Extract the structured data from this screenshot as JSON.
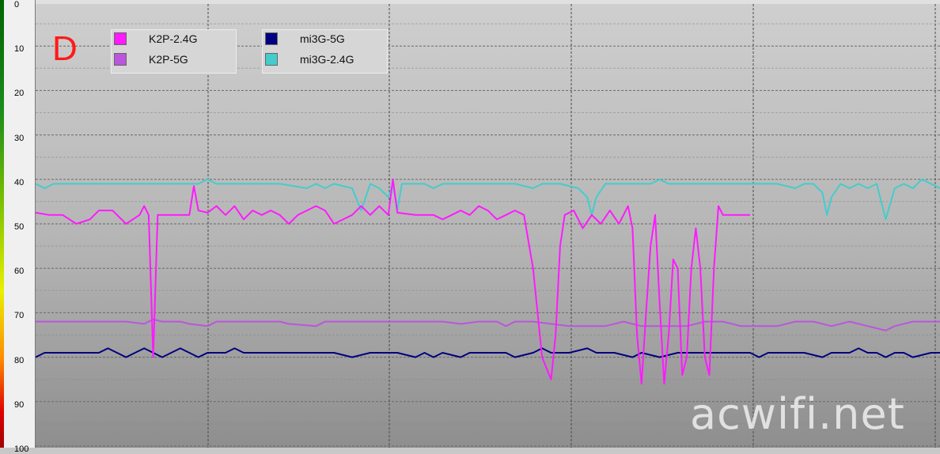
{
  "panel_label": "D",
  "watermark": "acwifi.net",
  "colors": {
    "k2p_24": "#ff1aff",
    "k2p_5": "#bb55dd",
    "mi3g_5": "#000080",
    "mi3g_24": "#44cccc"
  },
  "chart_data": {
    "type": "line",
    "ylim": [
      0,
      100
    ],
    "y_inverted": true,
    "yticks": [
      "0",
      "10",
      "20",
      "30",
      "40",
      "50",
      "60",
      "70",
      "80",
      "90",
      "100"
    ],
    "xlim": [
      0,
      100
    ],
    "grid": true,
    "legend_position": "top-left",
    "series": [
      {
        "name": "K2P-2.4G",
        "color": "#ff1aff",
        "points": [
          [
            0,
            47.5
          ],
          [
            1.5,
            48
          ],
          [
            3,
            48
          ],
          [
            4.5,
            50
          ],
          [
            6,
            49
          ],
          [
            7,
            47
          ],
          [
            8.5,
            47
          ],
          [
            10,
            50
          ],
          [
            11.5,
            48
          ],
          [
            12,
            46
          ],
          [
            12.5,
            48
          ],
          [
            13,
            80
          ],
          [
            13.5,
            48
          ],
          [
            15,
            48
          ],
          [
            17,
            48
          ],
          [
            17,
            48
          ],
          [
            17.5,
            41.5
          ],
          [
            18,
            47
          ],
          [
            19,
            47.5
          ],
          [
            20,
            46
          ],
          [
            21,
            48
          ],
          [
            22,
            46
          ],
          [
            23,
            49
          ],
          [
            24,
            47
          ],
          [
            25,
            48
          ],
          [
            26,
            47
          ],
          [
            27,
            48
          ],
          [
            28,
            50
          ],
          [
            29,
            48
          ],
          [
            30,
            47
          ],
          [
            31,
            46
          ],
          [
            32,
            47
          ],
          [
            33,
            50
          ],
          [
            34,
            49
          ],
          [
            35,
            48
          ],
          [
            36,
            46
          ],
          [
            37,
            48
          ],
          [
            38,
            46
          ],
          [
            39,
            48
          ],
          [
            39.5,
            40
          ],
          [
            40,
            47.5
          ],
          [
            42,
            48
          ],
          [
            44,
            48
          ],
          [
            45,
            49
          ],
          [
            46,
            48
          ],
          [
            47,
            47
          ],
          [
            48,
            48
          ],
          [
            49,
            46
          ],
          [
            50,
            47
          ],
          [
            51,
            49
          ],
          [
            52,
            48
          ],
          [
            53,
            47
          ],
          [
            54,
            48
          ],
          [
            55,
            60
          ],
          [
            56,
            80
          ],
          [
            57,
            85
          ],
          [
            57.5,
            75
          ],
          [
            58,
            55
          ],
          [
            58.5,
            48
          ],
          [
            59.5,
            47
          ],
          [
            60.5,
            51
          ],
          [
            61.5,
            48
          ],
          [
            62.5,
            50
          ],
          [
            63.5,
            47
          ],
          [
            64.5,
            50
          ],
          [
            65,
            48
          ],
          [
            65.5,
            46
          ],
          [
            66,
            51
          ],
          [
            66.5,
            75
          ],
          [
            67,
            86
          ],
          [
            67.5,
            70
          ],
          [
            68,
            55
          ],
          [
            68.5,
            48
          ],
          [
            69,
            68
          ],
          [
            69.5,
            86
          ],
          [
            70,
            75
          ],
          [
            70.5,
            58
          ],
          [
            71,
            60
          ],
          [
            71.5,
            84
          ],
          [
            72,
            80
          ],
          [
            72.5,
            60
          ],
          [
            73,
            51
          ],
          [
            73.5,
            60
          ],
          [
            74,
            80
          ],
          [
            74.5,
            84
          ],
          [
            75,
            60
          ],
          [
            75.5,
            46
          ],
          [
            76,
            48
          ],
          [
            78,
            48
          ],
          [
            79,
            48
          ]
        ]
      },
      {
        "name": "K2P-5G",
        "color": "#bb55dd",
        "points": [
          [
            0,
            72
          ],
          [
            5,
            72
          ],
          [
            10,
            72
          ],
          [
            12,
            72.5
          ],
          [
            13,
            71.5
          ],
          [
            14,
            72
          ],
          [
            16,
            72
          ],
          [
            17,
            72.5
          ],
          [
            19,
            73
          ],
          [
            20,
            72
          ],
          [
            25,
            72
          ],
          [
            26,
            72
          ],
          [
            27,
            72
          ],
          [
            28,
            72.5
          ],
          [
            31,
            73
          ],
          [
            32,
            72
          ],
          [
            35,
            72
          ],
          [
            37,
            72
          ],
          [
            40,
            72
          ],
          [
            42,
            72
          ],
          [
            45,
            72
          ],
          [
            47,
            72.5
          ],
          [
            49,
            72
          ],
          [
            50,
            72
          ],
          [
            51,
            72
          ],
          [
            52,
            73
          ],
          [
            53,
            72
          ],
          [
            55,
            72
          ],
          [
            57,
            72.5
          ],
          [
            59,
            73
          ],
          [
            60,
            73
          ],
          [
            63,
            73
          ],
          [
            65,
            72
          ],
          [
            67,
            73
          ],
          [
            70,
            73
          ],
          [
            72,
            73
          ],
          [
            74,
            72
          ],
          [
            76,
            72
          ],
          [
            78,
            73
          ],
          [
            82,
            73
          ],
          [
            84,
            72
          ],
          [
            86,
            72
          ],
          [
            88,
            73
          ],
          [
            90,
            72
          ],
          [
            92,
            73
          ],
          [
            94,
            74
          ],
          [
            95,
            73
          ],
          [
            97,
            72
          ],
          [
            99,
            72
          ],
          [
            100,
            72
          ]
        ]
      },
      {
        "name": "mi3G-5G",
        "color": "#000080",
        "points": [
          [
            0,
            80
          ],
          [
            1,
            79
          ],
          [
            5,
            79
          ],
          [
            7,
            79
          ],
          [
            8,
            78
          ],
          [
            9,
            79
          ],
          [
            10,
            80
          ],
          [
            11,
            79
          ],
          [
            12,
            78
          ],
          [
            13,
            79
          ],
          [
            14,
            80
          ],
          [
            15,
            79
          ],
          [
            16,
            78
          ],
          [
            17,
            79
          ],
          [
            18,
            80
          ],
          [
            19,
            79
          ],
          [
            21,
            79
          ],
          [
            22,
            78
          ],
          [
            23,
            79
          ],
          [
            25,
            79
          ],
          [
            30,
            79
          ],
          [
            33,
            79
          ],
          [
            35,
            80
          ],
          [
            37,
            79
          ],
          [
            40,
            79
          ],
          [
            42,
            80
          ],
          [
            43,
            79
          ],
          [
            44,
            80
          ],
          [
            45,
            79
          ],
          [
            47,
            80
          ],
          [
            48,
            79
          ],
          [
            50,
            79
          ],
          [
            52,
            79
          ],
          [
            53,
            80
          ],
          [
            55,
            79
          ],
          [
            56,
            78
          ],
          [
            57,
            79
          ],
          [
            59,
            79
          ],
          [
            61,
            78
          ],
          [
            62,
            79
          ],
          [
            64,
            79
          ],
          [
            66,
            80
          ],
          [
            67,
            79
          ],
          [
            69,
            80
          ],
          [
            71,
            79
          ],
          [
            73,
            79
          ],
          [
            75,
            79
          ],
          [
            77,
            79
          ],
          [
            79,
            79
          ],
          [
            80,
            80
          ],
          [
            81,
            79
          ],
          [
            83,
            79
          ],
          [
            85,
            79
          ],
          [
            87,
            80
          ],
          [
            88,
            79
          ],
          [
            90,
            79
          ],
          [
            91,
            78
          ],
          [
            92,
            79
          ],
          [
            93,
            79
          ],
          [
            94,
            80
          ],
          [
            95,
            79
          ],
          [
            96,
            79
          ],
          [
            97,
            80
          ],
          [
            99,
            79
          ],
          [
            100,
            79
          ]
        ]
      },
      {
        "name": "mi3G-2.4G",
        "color": "#44cccc",
        "points": [
          [
            0,
            41
          ],
          [
            1,
            42
          ],
          [
            2,
            41
          ],
          [
            5,
            41
          ],
          [
            10,
            41
          ],
          [
            15,
            41
          ],
          [
            18,
            41
          ],
          [
            19,
            40
          ],
          [
            20,
            41
          ],
          [
            25,
            41
          ],
          [
            27,
            41
          ],
          [
            30,
            42
          ],
          [
            31,
            41
          ],
          [
            32,
            42
          ],
          [
            33,
            41
          ],
          [
            35,
            42
          ],
          [
            36,
            47
          ],
          [
            37,
            41
          ],
          [
            38,
            42
          ],
          [
            39,
            44
          ],
          [
            39.5,
            41
          ],
          [
            40,
            47
          ],
          [
            40.5,
            41
          ],
          [
            42,
            41
          ],
          [
            43,
            41
          ],
          [
            44,
            42
          ],
          [
            45,
            41
          ],
          [
            47,
            41
          ],
          [
            50,
            41
          ],
          [
            53,
            41
          ],
          [
            55,
            42
          ],
          [
            56,
            41
          ],
          [
            58,
            41
          ],
          [
            60,
            42
          ],
          [
            61,
            44
          ],
          [
            61.5,
            48
          ],
          [
            62,
            44
          ],
          [
            63,
            41
          ],
          [
            65,
            41
          ],
          [
            66,
            41
          ],
          [
            68,
            41
          ],
          [
            69,
            40
          ],
          [
            70,
            41
          ],
          [
            72,
            41
          ],
          [
            75,
            41
          ],
          [
            78,
            41
          ],
          [
            80,
            41
          ],
          [
            82,
            41
          ],
          [
            84,
            42
          ],
          [
            85,
            41
          ],
          [
            86,
            41
          ],
          [
            87,
            43
          ],
          [
            87.5,
            48
          ],
          [
            88,
            44
          ],
          [
            89,
            41
          ],
          [
            90,
            42
          ],
          [
            91,
            41
          ],
          [
            92,
            42
          ],
          [
            93,
            41
          ],
          [
            94,
            49
          ],
          [
            95,
            42
          ],
          [
            96,
            41
          ],
          [
            97,
            42
          ],
          [
            98,
            40
          ],
          [
            99,
            41
          ],
          [
            100,
            42
          ]
        ]
      }
    ]
  }
}
